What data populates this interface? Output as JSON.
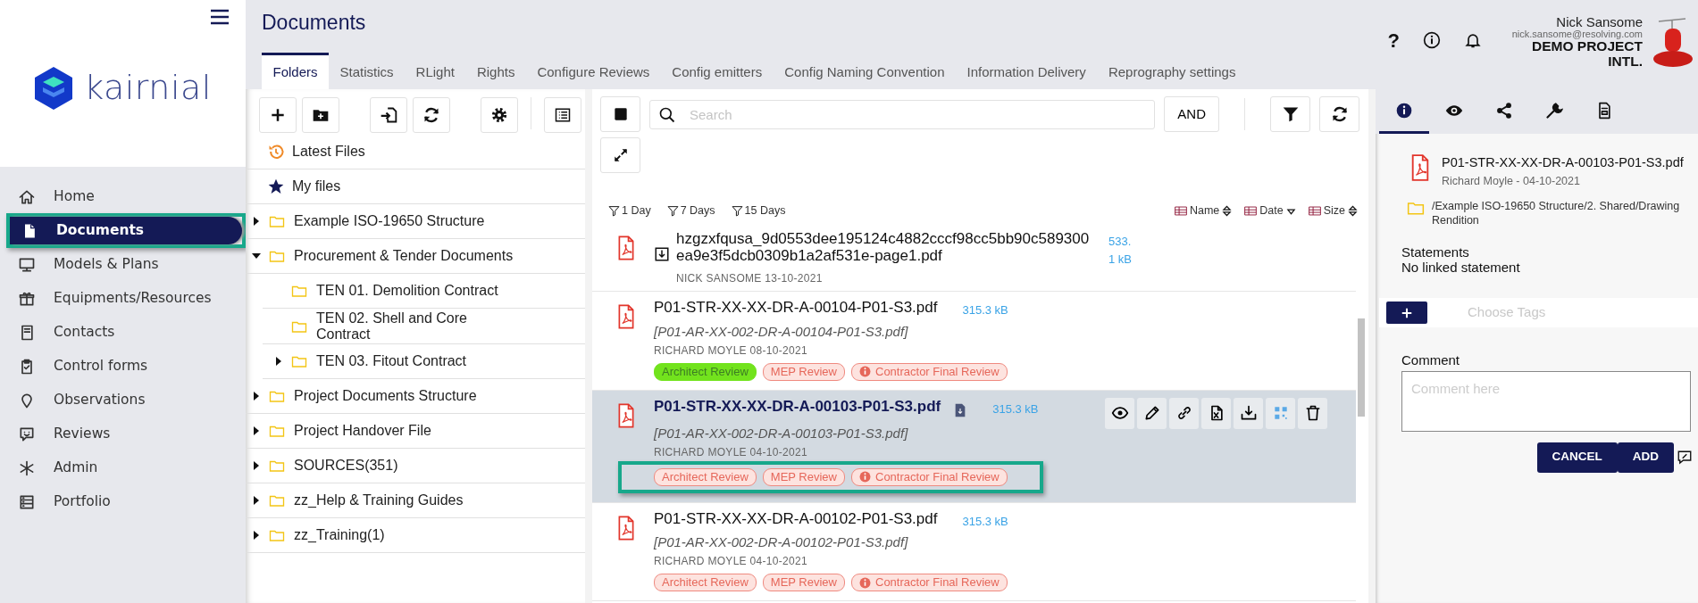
{
  "sidebar": {
    "logo_text": "kairnial",
    "items": [
      {
        "label": "Home",
        "kind": "home",
        "selected": false,
        "highlighted": false
      },
      {
        "label": "Documents",
        "kind": "document",
        "selected": true,
        "highlighted": true
      },
      {
        "label": "Models & Plans",
        "kind": "monitor",
        "selected": false,
        "highlighted": false
      },
      {
        "label": "Equipments/Resources",
        "kind": "gift",
        "selected": false,
        "highlighted": false
      },
      {
        "label": "Contacts",
        "kind": "book",
        "selected": false,
        "highlighted": false
      },
      {
        "label": "Control forms",
        "kind": "clipboard",
        "selected": false,
        "highlighted": false
      },
      {
        "label": "Observations",
        "kind": "pin",
        "selected": false,
        "highlighted": false
      },
      {
        "label": "Reviews",
        "kind": "chat",
        "selected": false,
        "highlighted": false
      },
      {
        "label": "Admin",
        "kind": "asterisk",
        "selected": false,
        "highlighted": false
      },
      {
        "label": "Portfolio",
        "kind": "server",
        "selected": false,
        "highlighted": false
      }
    ]
  },
  "header": {
    "title": "Documents",
    "tabs": [
      {
        "label": "Folders",
        "selected": true
      },
      {
        "label": "Statistics",
        "selected": false
      },
      {
        "label": "RLight",
        "selected": false
      },
      {
        "label": "Rights",
        "selected": false
      },
      {
        "label": "Configure Reviews",
        "selected": false
      },
      {
        "label": "Config emitters",
        "selected": false
      },
      {
        "label": "Config Naming Convention",
        "selected": false
      },
      {
        "label": "Information Delivery",
        "selected": false
      },
      {
        "label": "Reprography settings",
        "selected": false
      }
    ],
    "help_label": "?",
    "user": {
      "name": "Nick Sansome",
      "email": "nick.sansome@resolving.com",
      "project": "DEMO PROJECT INTL."
    }
  },
  "folder_tree": {
    "shortcuts": [
      {
        "label": "Latest Files",
        "kind": "recent"
      },
      {
        "label": "My files",
        "kind": "starred"
      }
    ],
    "folders": [
      {
        "label": "Example ISO-19650 Structure",
        "expanded": false
      },
      {
        "label": "Procurement & Tender Documents",
        "expanded": true,
        "children": [
          {
            "label": "TEN 01. Demolition Contract"
          },
          {
            "label": "TEN 02. Shell and Core Contract"
          },
          {
            "label": "TEN 03. Fitout Contract",
            "expanded": false
          }
        ]
      },
      {
        "label": "Project Documents Structure",
        "expanded": false
      },
      {
        "label": "Project Handover File",
        "expanded": false
      },
      {
        "label": "SOURCES(351)",
        "expanded": false
      },
      {
        "label": "zz_Help & Training Guides",
        "expanded": false
      },
      {
        "label": "zz_Training(1)",
        "expanded": false
      }
    ]
  },
  "documents": {
    "search": {
      "placeholder": "Search"
    },
    "operator": "AND",
    "date_filters": [
      "1 Day",
      "7 Days",
      "15 Days"
    ],
    "sort_columns": [
      {
        "label": "Name",
        "descending": false
      },
      {
        "label": "Date",
        "descending": true
      },
      {
        "label": "Size",
        "descending": false
      }
    ],
    "actions": [
      {
        "kind": "view"
      },
      {
        "kind": "edit"
      },
      {
        "kind": "link"
      },
      {
        "kind": "export"
      },
      {
        "kind": "download"
      },
      {
        "kind": "qr"
      },
      {
        "kind": "delete"
      }
    ],
    "rows": [
      {
        "kind": "downloadable",
        "name": "hzgzxfqusa_9d0553dee195124c4882cccf98cc5bb90c589300ea9e3f5dcb0309b1a2af531e-page1.pdf",
        "author_date": "NICK SANSOME 13-10-2021",
        "size": "533.1 kB",
        "selected": false,
        "attachment": false,
        "highlighted": false,
        "reviews": []
      },
      {
        "kind": "standard",
        "name": "P01-STR-XX-XX-DR-A-00104-P01-S3.pdf",
        "original_name": "[P01-AR-XX-002-DR-A-00104-P01-S3.pdf]",
        "author_date": "RICHARD MOYLE 08-10-2021",
        "size": "315.3 kB",
        "selected": false,
        "attachment": false,
        "highlighted": false,
        "reviews": [
          {
            "label": "Architect Review",
            "approved": true,
            "info": false
          },
          {
            "label": "MEP Review",
            "approved": false,
            "info": false
          },
          {
            "label": "Contractor Final Review",
            "approved": false,
            "info": true
          }
        ]
      },
      {
        "kind": "standard",
        "name": "P01-STR-XX-XX-DR-A-00103-P01-S3.pdf",
        "original_name": "[P01-AR-XX-002-DR-A-00103-P01-S3.pdf]",
        "author_date": "RICHARD MOYLE 04-10-2021",
        "size": "315.3 kB",
        "selected": true,
        "attachment": true,
        "highlighted": true,
        "reviews": [
          {
            "label": "Architect Review",
            "approved": false,
            "info": false
          },
          {
            "label": "MEP Review",
            "approved": false,
            "info": false
          },
          {
            "label": "Contractor Final Review",
            "approved": false,
            "info": true
          }
        ]
      },
      {
        "kind": "standard",
        "name": "P01-STR-XX-XX-DR-A-00102-P01-S3.pdf",
        "original_name": "[P01-AR-XX-002-DR-A-00102-P01-S3.pdf]",
        "author_date": "RICHARD MOYLE 04-10-2021",
        "size": "315.3 kB",
        "selected": false,
        "attachment": false,
        "highlighted": false,
        "reviews": [
          {
            "label": "Architect Review",
            "approved": false,
            "info": false
          },
          {
            "label": "MEP Review",
            "approved": false,
            "info": false
          },
          {
            "label": "Contractor Final Review",
            "approved": false,
            "info": true
          }
        ]
      }
    ]
  },
  "details": {
    "tabs": [
      {
        "kind": "info",
        "selected": true
      },
      {
        "kind": "view",
        "selected": false
      },
      {
        "kind": "share",
        "selected": false
      },
      {
        "kind": "tools",
        "selected": false
      },
      {
        "kind": "report",
        "selected": false
      }
    ],
    "file_name": "P01-STR-XX-XX-DR-A-00103-P01-S3.pdf",
    "author_date": "Richard Moyle - 04-10-2021",
    "path": "/Example ISO-19650 Structure/2. Shared/Drawing Rendition",
    "statements_label": "Statements",
    "statements_value": "No linked statement",
    "tags_placeholder": "Choose Tags",
    "comment_label": "Comment",
    "comment_placeholder": "Comment here",
    "buttons": [
      "CANCEL",
      "ADD"
    ]
  }
}
